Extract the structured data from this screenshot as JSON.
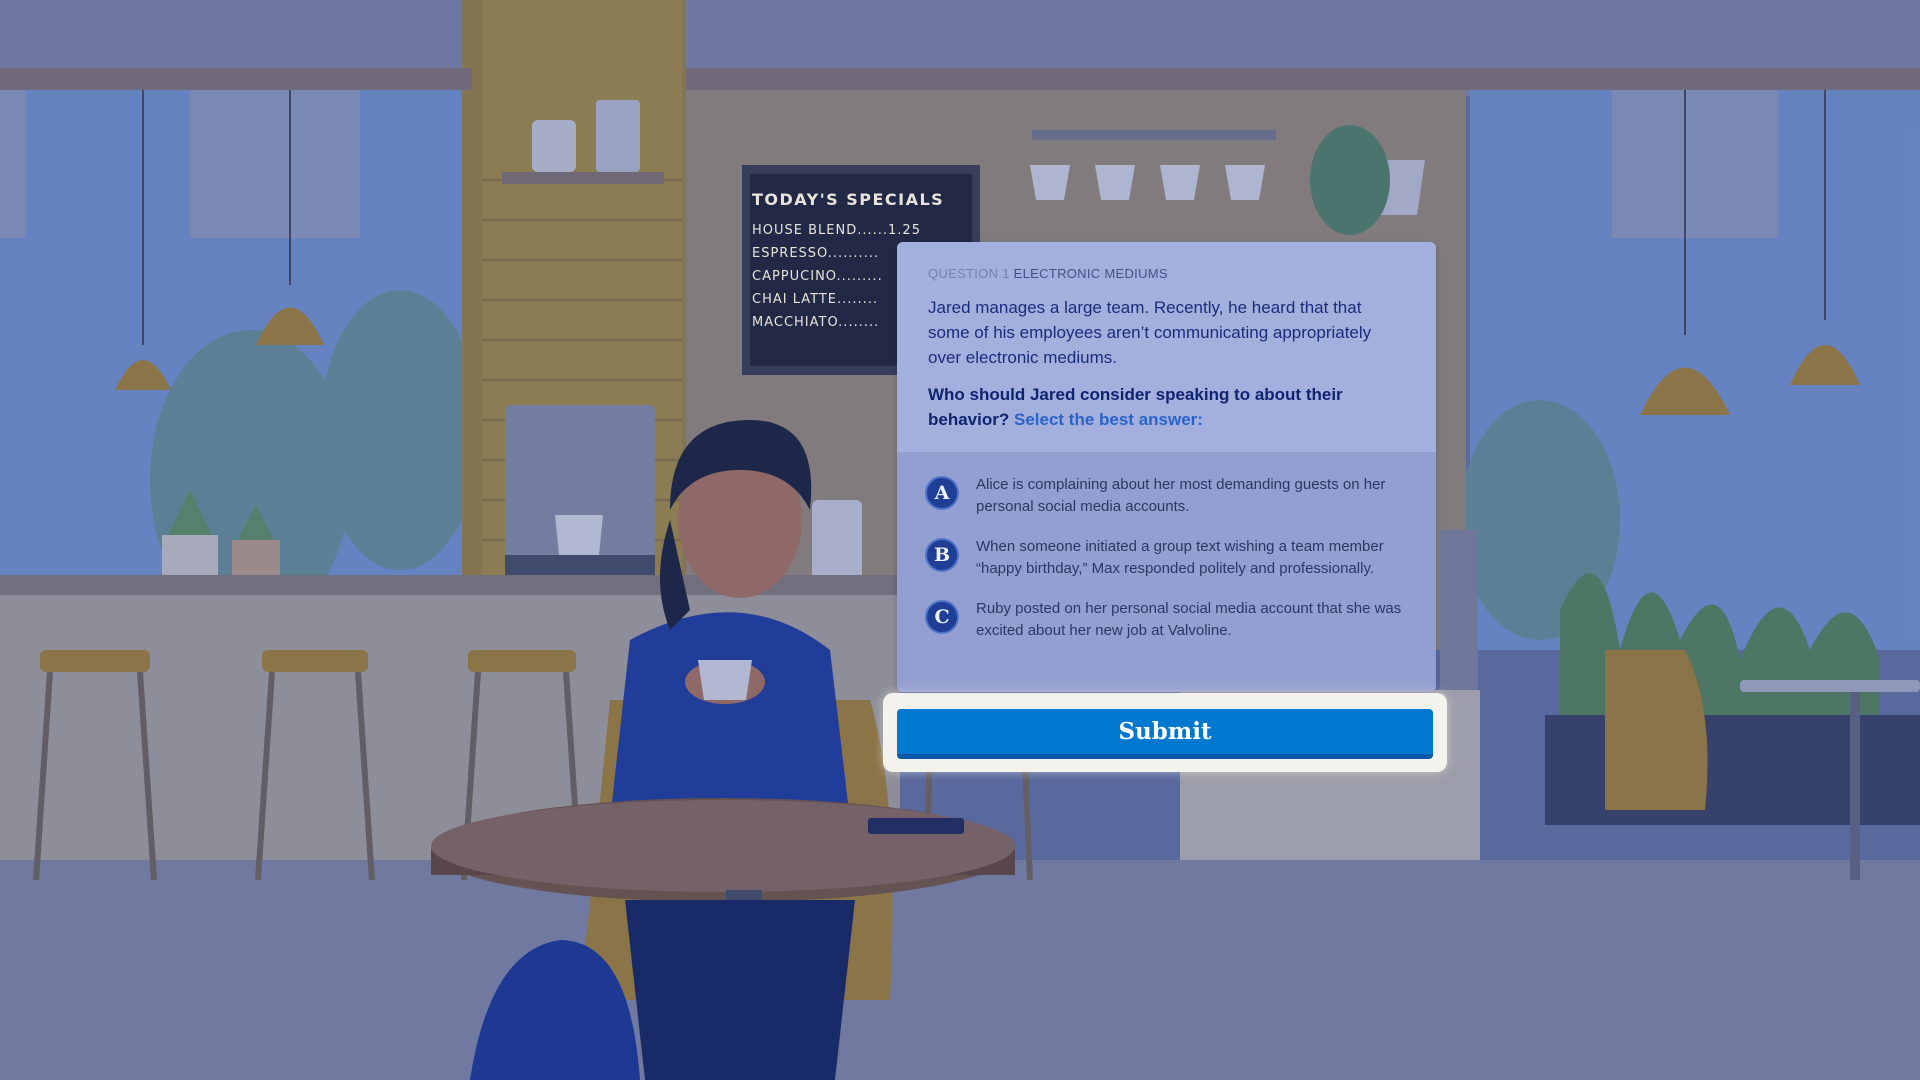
{
  "board": {
    "title": "TODAY'S SPECIALS",
    "items": [
      "HOUSE BLEND......1.25",
      "ESPRESSO..........",
      "CAPPUCINO.........",
      "CHAI LATTE........",
      "MACCHIATO........"
    ]
  },
  "question": {
    "number_label": "QUESTION 1",
    "category": "ELECTRONIC MEDIUMS",
    "stem": "Jared manages a large team. Recently, he heard that that some of his employees aren’t communicating appropriately over electronic mediums.",
    "prompt": "Who should Jared consider speaking to about their behavior?",
    "hint": "Select the best answer:"
  },
  "options": [
    {
      "letter": "A",
      "text": "Alice is complaining about her most demanding guests on her personal social media accounts."
    },
    {
      "letter": "B",
      "text": "When someone initiated a group text wishing a team member “happy birthday,” Max responded politely and professionally."
    },
    {
      "letter": "C",
      "text": "Ruby posted on her personal social media account that she was excited about her new job at Valvoline."
    }
  ],
  "submit_label": "Submit",
  "colors": {
    "accent": "#0078d0",
    "badge": "#1f3f97",
    "overlay": "#2c3c8c"
  }
}
